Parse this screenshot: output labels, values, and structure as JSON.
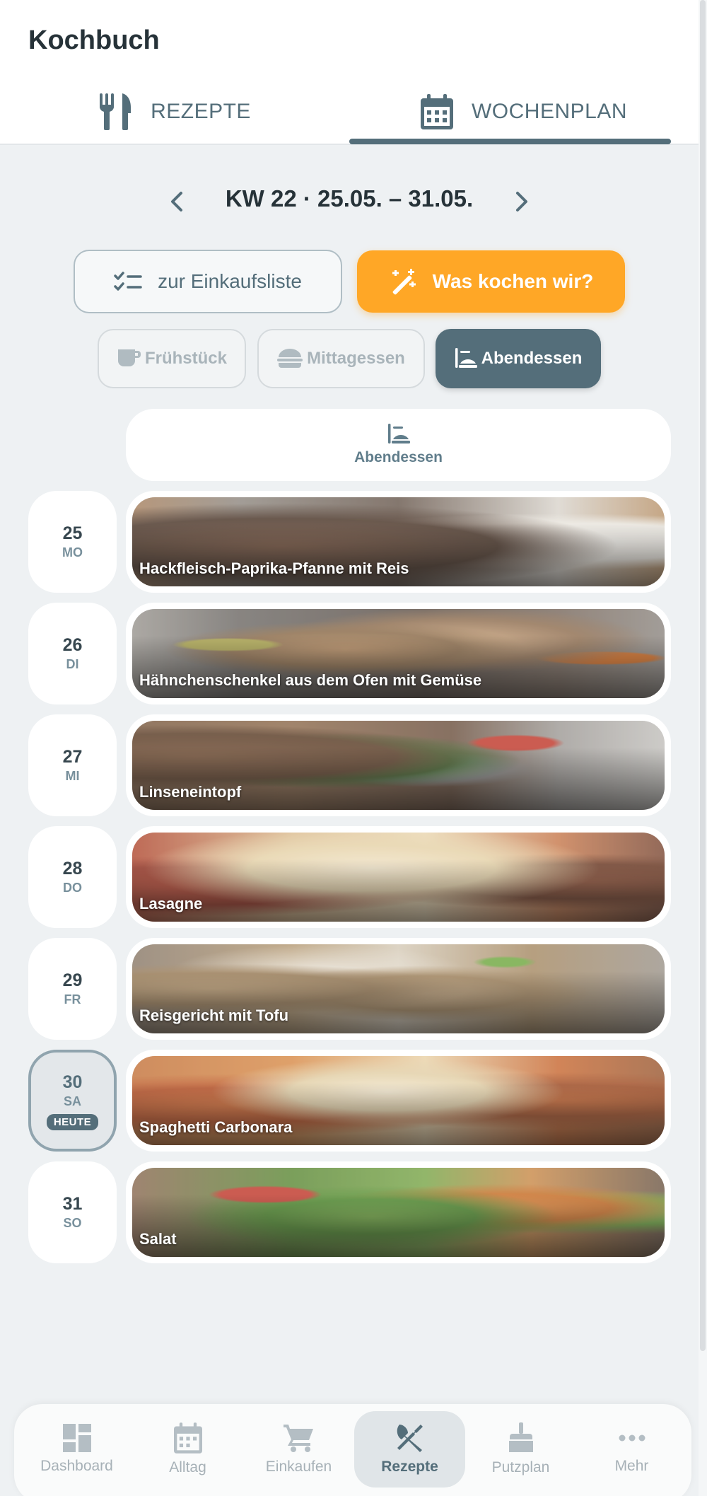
{
  "app": {
    "title": "Kochbuch"
  },
  "tabs": [
    {
      "label": "REZEPTE",
      "icon": "fork-knife-icon"
    },
    {
      "label": "WOCHENPLAN",
      "icon": "calendar-icon",
      "active": true
    }
  ],
  "week": {
    "title": "KW 22 · 25.05. – 31.05."
  },
  "actions": {
    "shopping_label": "zur Einkaufsliste",
    "cook_label": "Was kochen wir?"
  },
  "meal_types": [
    {
      "label": "Frühstück",
      "icon": "coffee-cup-icon",
      "active": false
    },
    {
      "label": "Mittagessen",
      "icon": "burger-icon",
      "active": false
    },
    {
      "label": "Abendessen",
      "icon": "dinner-plate-icon",
      "active": true
    }
  ],
  "column": {
    "label": "Abendessen"
  },
  "days": [
    {
      "num": "25",
      "weekday": "MO",
      "meal": "Hackfleisch-Paprika-Pfanne mit Reis"
    },
    {
      "num": "26",
      "weekday": "DI",
      "meal": "Hähnchenschenkel aus dem Ofen mit Gemüse"
    },
    {
      "num": "27",
      "weekday": "MI",
      "meal": "Linseneintopf"
    },
    {
      "num": "28",
      "weekday": "DO",
      "meal": "Lasagne"
    },
    {
      "num": "29",
      "weekday": "FR",
      "meal": "Reisgericht mit Tofu"
    },
    {
      "num": "30",
      "weekday": "SA",
      "meal": "Spaghetti Carbonara",
      "badge": "HEUTE"
    },
    {
      "num": "31",
      "weekday": "SO",
      "meal": "Salat"
    }
  ],
  "bottom_nav": [
    {
      "label": "Dashboard",
      "icon": "dashboard-icon"
    },
    {
      "label": "Alltag",
      "icon": "calendar-icon"
    },
    {
      "label": "Einkaufen",
      "icon": "cart-icon"
    },
    {
      "label": "Rezepte",
      "icon": "utensils-icon",
      "active": true
    },
    {
      "label": "Putzplan",
      "icon": "broom-icon"
    },
    {
      "label": "Mehr",
      "icon": "more-dots-icon"
    }
  ],
  "colors": {
    "primary": "#546e7a",
    "accent": "#ffa726",
    "background": "#eef1f3"
  }
}
